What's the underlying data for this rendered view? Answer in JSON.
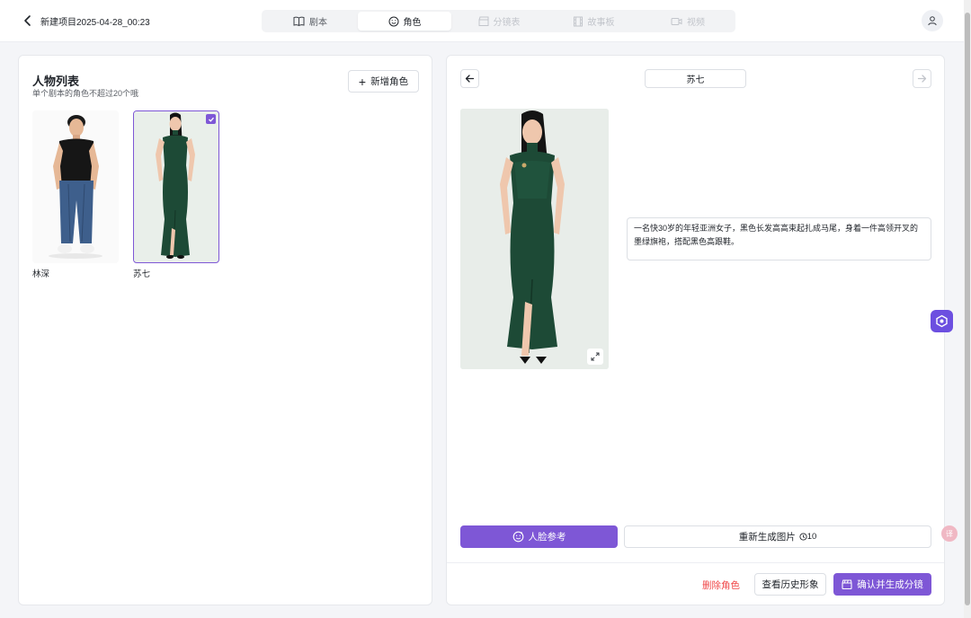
{
  "header": {
    "project_title": "新建项目2025-04-28_00:23",
    "tabs": [
      {
        "label": "剧本",
        "state": "normal",
        "icon": "book-icon"
      },
      {
        "label": "角色",
        "state": "active",
        "icon": "smile-icon"
      },
      {
        "label": "分镜表",
        "state": "disabled",
        "icon": "clapper-icon"
      },
      {
        "label": "故事板",
        "state": "disabled",
        "icon": "film-icon"
      },
      {
        "label": "视频",
        "state": "disabled",
        "icon": "video-icon"
      }
    ]
  },
  "character_list": {
    "title": "人物列表",
    "subtitle": "单个剧本的角色不超过20个哦",
    "add_label": "新增角色",
    "characters": [
      {
        "name": "林深",
        "selected": false
      },
      {
        "name": "苏七",
        "selected": true
      }
    ]
  },
  "detail": {
    "name": "苏七",
    "description": "一名快30岁的年轻亚洲女子，黑色长发高高束起扎成马尾，身着一件高领开叉的墨绿旗袍，搭配黑色高跟鞋。",
    "face_ref_label": "人脸参考",
    "regen_label": "重新生成图片",
    "regen_cost": "10",
    "delete_label": "删除角色",
    "history_label": "查看历史形象",
    "confirm_label": "确认并生成分镜"
  },
  "floating": {
    "translate_label": "译"
  },
  "colors": {
    "accent": "#7e57d6",
    "danger": "#f0494a",
    "dress_green": "#1d4a36"
  }
}
